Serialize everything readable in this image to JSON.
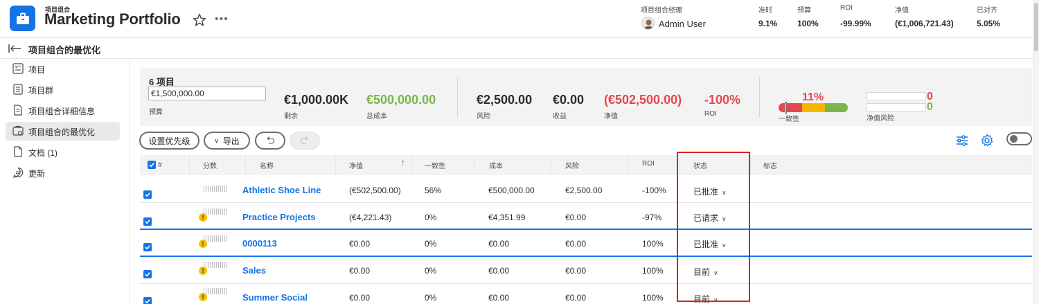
{
  "header": {
    "breadcrumb_label": "项目组合",
    "title": "Marketing Portfolio",
    "manager_label": "项目组合经理",
    "manager_name": "Admin User",
    "stats": [
      {
        "label": "准时",
        "value": "9.1%"
      },
      {
        "label": "预算",
        "value": "100%"
      },
      {
        "label": "ROI",
        "value": "-99.99%"
      },
      {
        "label": "净值",
        "value": "(€1,006,721.43)"
      },
      {
        "label": "已对齐",
        "value": "5.05%"
      }
    ]
  },
  "subheader": {
    "title": "项目组合的最优化"
  },
  "sidebar": {
    "items": [
      {
        "label": "项目",
        "icon": "project-list-icon",
        "active": false
      },
      {
        "label": "项目群",
        "icon": "program-icon",
        "active": false
      },
      {
        "label": "项目组合详细信息",
        "icon": "details-icon",
        "active": false
      },
      {
        "label": "项目组合的最优化",
        "icon": "optimizer-icon",
        "active": true
      },
      {
        "label": "文档 (1)",
        "icon": "document-icon",
        "active": false
      },
      {
        "label": "更新",
        "icon": "updates-icon",
        "active": false
      }
    ]
  },
  "summary": {
    "project_count": "6 项目",
    "budget_value": "€1,500,000.00",
    "budget_label": "预算",
    "remaining_value": "€1,000.00K",
    "remaining_label": "剩余",
    "total_cost_value": "€500,000.00",
    "total_cost_label": "总成本",
    "risk_value": "€2,500.00",
    "risk_label": "风险",
    "revenue_value": "€0.00",
    "revenue_label": "收益",
    "net_value": "(€502,500.00)",
    "net_label": "净值",
    "roi_value": "-100%",
    "roi_label": "ROI",
    "alignment_value": "11%",
    "alignment_fraction": 0.11,
    "alignment_label": "一致性",
    "net_risk_top": "0",
    "net_risk_bottom": "0",
    "net_risk_label": "净值风险"
  },
  "toolbar": {
    "prioritize_label": "设置优先级",
    "export_label": "导出"
  },
  "table": {
    "headers": {
      "number": "#",
      "score": "分数",
      "name": "名称",
      "net": "净值",
      "alignment": "一致性",
      "cost": "成本",
      "risk": "风险",
      "roi": "ROI",
      "status": "状态",
      "flags": "标志"
    },
    "rows": [
      {
        "name": "Athletic Shoe Line",
        "net": "(€502,500.00)",
        "alignment": "56%",
        "cost": "€500,000.00",
        "risk": "€2,500.00",
        "roi": "-100%",
        "status": "已批准",
        "warning": false
      },
      {
        "name": "Practice Projects",
        "net": "(€4,221.43)",
        "alignment": "0%",
        "cost": "€4,351.99",
        "risk": "€0.00",
        "roi": "-97%",
        "status": "已请求",
        "warning": true
      },
      {
        "name": "0000113",
        "net": "€0.00",
        "alignment": "0%",
        "cost": "€0.00",
        "risk": "€0.00",
        "roi": "100%",
        "status": "已批准",
        "warning": true
      },
      {
        "name": "Sales",
        "net": "€0.00",
        "alignment": "0%",
        "cost": "€0.00",
        "risk": "€0.00",
        "roi": "100%",
        "status": "目前",
        "warning": true
      },
      {
        "name": "Summer Social",
        "net": "€0.00",
        "alignment": "0%",
        "cost": "€0.00",
        "risk": "€0.00",
        "roi": "100%",
        "status": "目前",
        "warning": true
      }
    ]
  },
  "colors": {
    "accent": "#1473e6",
    "positive": "#7ab648",
    "negative": "#e34850",
    "warning": "#f5c200",
    "highlight_box": "#e01e1e"
  }
}
